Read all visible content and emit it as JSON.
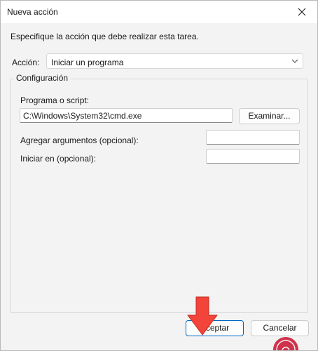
{
  "window": {
    "title": "Nueva acción"
  },
  "instruction": "Especifique la acción que debe realizar esta tarea.",
  "action": {
    "label": "Acción:",
    "selected": "Iniciar un programa"
  },
  "config": {
    "group_title": "Configuración",
    "program_label": "Programa o script:",
    "program_value": "C:\\Windows\\System32\\cmd.exe",
    "browse_label": "Examinar...",
    "args_label": "Agregar argumentos (opcional):",
    "args_value": "",
    "start_in_label": "Iniciar en (opcional):",
    "start_in_value": ""
  },
  "footer": {
    "accept_label": "Aceptar",
    "cancel_label": "Cancelar"
  },
  "colors": {
    "accent": "#0067c0",
    "arrow": "#f2443a",
    "watermark_circle": "#c8102e"
  },
  "icons": {
    "close": "close-icon",
    "dropdown": "chevron-down-icon",
    "annotation": "red-arrow-down",
    "watermark": "solvetic-logo"
  }
}
